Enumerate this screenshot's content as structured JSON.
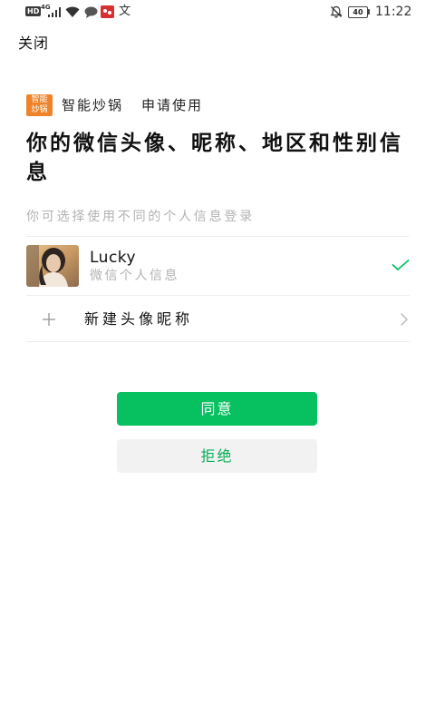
{
  "status_bar": {
    "hd_label": "HD",
    "network_label": "4G",
    "left_icons": [
      "signal-icon",
      "wifi-icon",
      "chat-bubble-icon",
      "app-notification-icon"
    ],
    "translate_glyph": "文",
    "right_icons": [
      "mute-icon",
      "battery-icon"
    ],
    "battery_level": "40",
    "time": "11:22"
  },
  "nav": {
    "close_label": "关闭"
  },
  "app": {
    "logo_line1": "智能",
    "logo_line2": "炒锅",
    "logo_color": "#F0832A",
    "name": "智能炒锅",
    "action": "申请使用"
  },
  "prompt": {
    "title": "你的微信头像、昵称、地区和性别信息",
    "subtitle": "你可选择使用不同的个人信息登录"
  },
  "profiles": [
    {
      "name": "Lucky",
      "source": "微信个人信息",
      "selected": true,
      "icon": "check-icon"
    }
  ],
  "new_profile": {
    "label": "新建头像昵称",
    "icon": "plus-icon",
    "trailing_icon": "chevron-right-icon"
  },
  "actions": {
    "agree_label": "同意",
    "refuse_label": "拒绝"
  },
  "colors": {
    "accent": "#07C160",
    "refuse_text": "#06AE56",
    "refuse_bg": "#F2F2F2",
    "secondary_text": "#B2B2B2",
    "divider": "#EDEDED"
  }
}
